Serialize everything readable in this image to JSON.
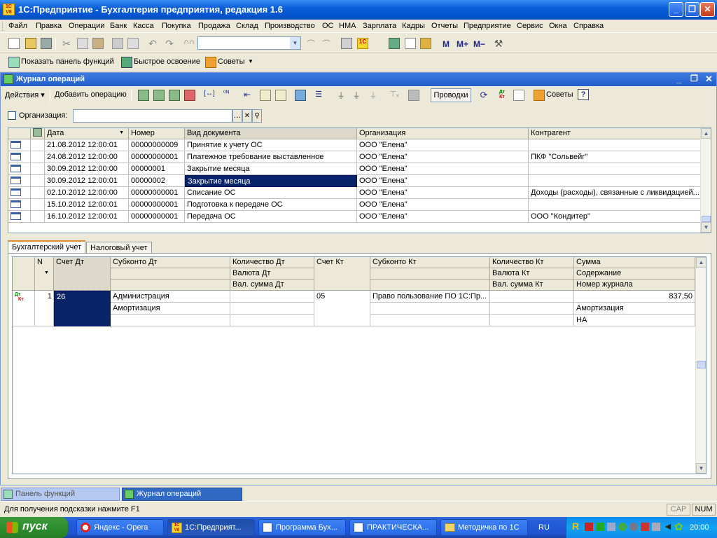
{
  "app": {
    "title": "1С:Предприятие - Бухгалтерия предприятия, редакция 1.6"
  },
  "menu": [
    "Файл",
    "Правка",
    "Операции",
    "Банк",
    "Касса",
    "Покупка",
    "Продажа",
    "Склад",
    "Производство",
    "ОС",
    "НМА",
    "Зарплата",
    "Кадры",
    "Отчеты",
    "Предприятие",
    "Сервис",
    "Окна",
    "Справка"
  ],
  "toolbar2": {
    "show_panel": "Показать панель функций",
    "quick": "Быстрое освоение",
    "tips": "Советы"
  },
  "journal": {
    "title": "Журнал операций",
    "actions": "Действия",
    "add_op": "Добавить операцию",
    "postings": "Проводки",
    "tips": "Советы",
    "org_label": "Организация:",
    "org_value": "",
    "columns": [
      "Дата",
      "Номер",
      "Вид документа",
      "Организация",
      "Контрагент"
    ],
    "rows": [
      [
        "21.08.2012 12:00:01",
        "00000000009",
        "Принятие к учету ОС",
        "ООО \"Елена\"",
        ""
      ],
      [
        "24.08.2012 12:00:00",
        "00000000001",
        "Платежное требование выставленное",
        "ООО \"Елена\"",
        "ПКФ \"Сольвейг\""
      ],
      [
        "30.09.2012 12:00:00",
        "00000001",
        "Закрытие месяца",
        "ООО \"Елена\"",
        ""
      ],
      [
        "30.09.2012 12:00:01",
        "00000002",
        "Закрытие месяца",
        "ООО \"Елена\"",
        ""
      ],
      [
        "02.10.2012 12:00:00",
        "00000000001",
        "Списание ОС",
        "ООО \"Елена\"",
        "Доходы (расходы), связанные с ликвидацией..."
      ],
      [
        "15.10.2012 12:00:01",
        "00000000001",
        "Подготовка к передаче ОС",
        "ООО \"Елена\"",
        ""
      ],
      [
        "16.10.2012 12:00:01",
        "00000000001",
        "Передача ОС",
        "ООО \"Елена\"",
        "ООО \"Кондитер\""
      ]
    ]
  },
  "tabs": [
    "Бухгалтерский учет",
    "Налоговый учет"
  ],
  "postings": {
    "headers": {
      "n": "N",
      "dt": "Счет Дт",
      "sub_dt": "Субконто Дт",
      "qty_dt": "Количество Дт",
      "cur_dt": "Валюта Дт",
      "cur_sum_dt": "Вал. сумма Дт",
      "kt": "Счет Кт",
      "sub_kt": "Субконто Кт",
      "qty_kt": "Количество Кт",
      "cur_kt": "Валюта Кт",
      "cur_sum_kt": "Вал. сумма Кт",
      "sum": "Сумма",
      "content": "Содержание",
      "journal_no": "Номер журнала"
    },
    "row": {
      "n": "1",
      "dt": "26",
      "sub_dt_1": "Администрация",
      "sub_dt_2": "Амортизация",
      "kt": "05",
      "sub_kt_1": "Право пользование ПО 1С:Пр...",
      "sum": "837,50",
      "content": "Амортизация",
      "journal_no": "НА",
      "icon_dt": "Дт",
      "icon_kt": "Кт"
    }
  },
  "windows": [
    "Панель функций",
    "Журнал операций"
  ],
  "status": {
    "hint": "Для получения подсказки нажмите F1",
    "cap": "CAP",
    "num": "NUM"
  },
  "taskbar": {
    "start": "пуск",
    "tasks": [
      "Яндекс - Opera",
      "1С:Предприят...",
      "Программа Бух...",
      "ПРАКТИЧЕСКА...",
      "Методичка по 1С"
    ],
    "lang": "RU",
    "clock": "20:00"
  }
}
